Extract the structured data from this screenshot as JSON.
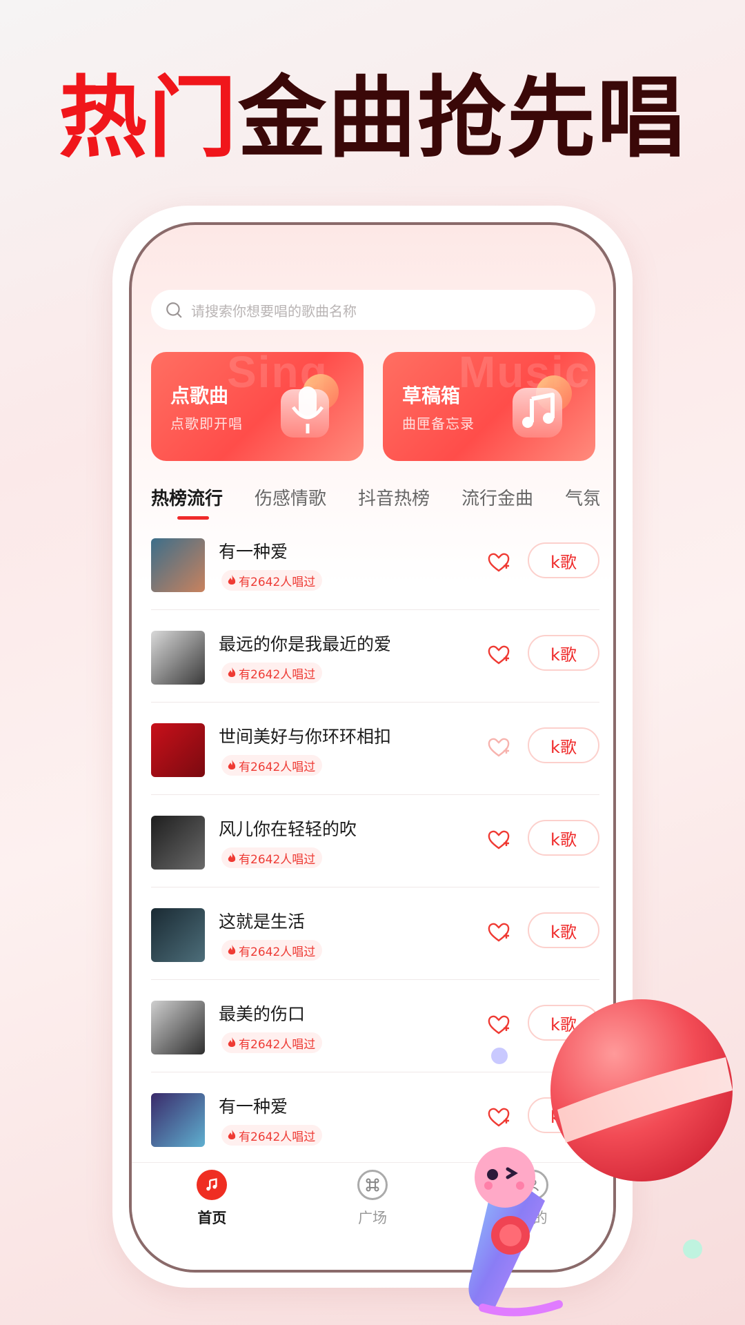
{
  "headline": {
    "part1": "热门",
    "part2": "金曲抢先唱"
  },
  "search": {
    "placeholder": "请搜索你想要唱的歌曲名称"
  },
  "feature_cards": [
    {
      "title": "点歌曲",
      "subtitle": "点歌即开唱",
      "ghost_text": "Sing"
    },
    {
      "title": "草稿箱",
      "subtitle": "曲匣备忘录",
      "ghost_text": "Music"
    }
  ],
  "tabs": [
    "热榜流行",
    "伤感情歌",
    "抖音热榜",
    "流行金曲",
    "气氛嗨"
  ],
  "songs": [
    {
      "title": "有一种爱",
      "badge": "有2642人唱过",
      "button": "k歌",
      "liked": false
    },
    {
      "title": "最远的你是我最近的爱",
      "badge": "有2642人唱过",
      "button": "k歌",
      "liked": false
    },
    {
      "title": "世间美好与你环环相扣",
      "badge": "有2642人唱过",
      "button": "k歌",
      "liked": false
    },
    {
      "title": "风儿你在轻轻的吹",
      "badge": "有2642人唱过",
      "button": "k歌",
      "liked": false
    },
    {
      "title": "这就是生活",
      "badge": "有2642人唱过",
      "button": "k歌",
      "liked": false
    },
    {
      "title": "最美的伤口",
      "badge": "有2642人唱过",
      "button": "k歌",
      "liked": false
    },
    {
      "title": "有一种爱",
      "badge": "有2642人唱过",
      "button": "k歌",
      "liked": false
    }
  ],
  "bottom_nav": [
    {
      "label": "首页",
      "icon": "music-note-icon",
      "active": true
    },
    {
      "label": "广场",
      "icon": "command-icon",
      "active": false
    },
    {
      "label": "我的",
      "icon": "user-icon",
      "active": false
    }
  ],
  "colors": {
    "accent": "#ef2a2a",
    "headline_dark": "#3a0808",
    "card_red": "#ff5a50"
  }
}
